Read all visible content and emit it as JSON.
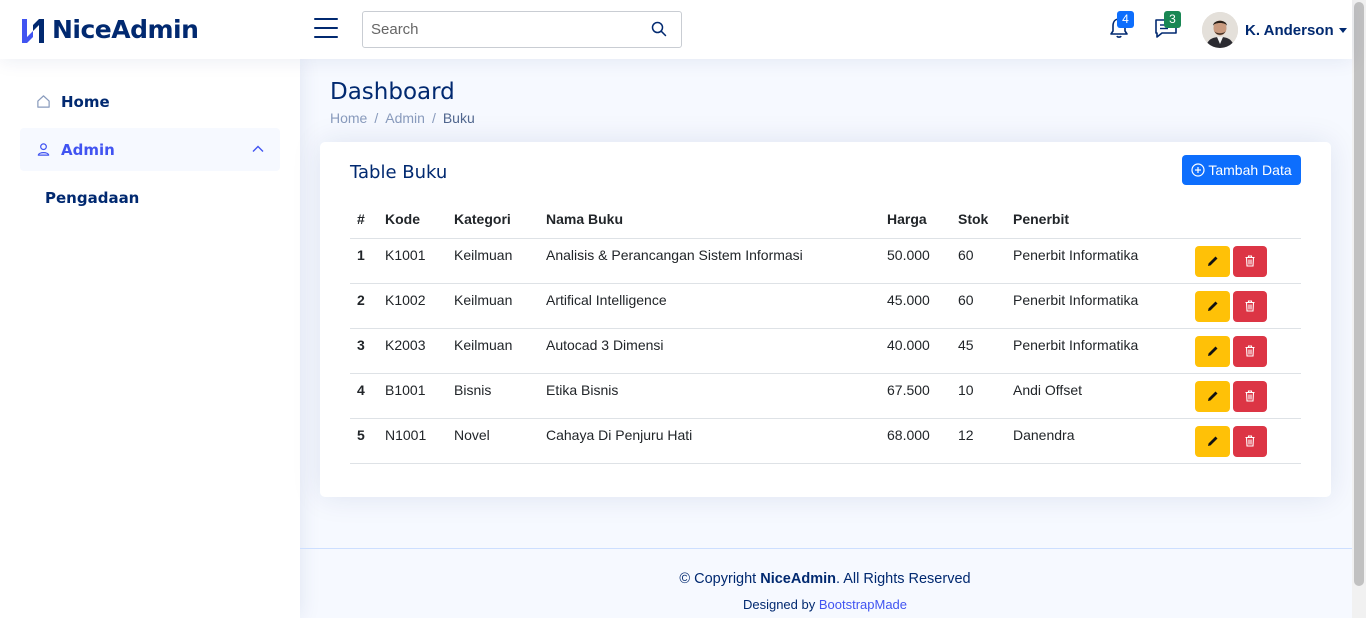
{
  "app": {
    "logo_text": "NiceAdmin"
  },
  "header": {
    "search_placeholder": "Search",
    "notifications": {
      "count": "4",
      "color": "#0d6efd",
      "icon": "bell-icon"
    },
    "messages": {
      "count": "3",
      "color": "#198754",
      "icon": "chat-left-text-icon"
    },
    "profile_name": "K. Anderson"
  },
  "sidebar": {
    "items": [
      {
        "label": "Home",
        "icon": "house-icon"
      },
      {
        "label": "Admin",
        "icon": "person-icon",
        "expanded": true
      }
    ],
    "sub_items": [
      {
        "label": "Pengadaan"
      }
    ]
  },
  "page": {
    "title": "Dashboard",
    "breadcrumb": [
      "Home",
      "Admin",
      "Buku"
    ]
  },
  "card": {
    "title": "Table Buku",
    "add_button": "Tambah Data",
    "columns": [
      "#",
      "Kode",
      "Kategori",
      "Nama Buku",
      "Harga",
      "Stok",
      "Penerbit",
      ""
    ],
    "rows": [
      {
        "no": "1",
        "kode": "K1001",
        "kategori": "Keilmuan",
        "nama": "Analisis & Perancangan Sistem Informasi",
        "harga": "50.000",
        "stok": "60",
        "penerbit": "Penerbit Informatika"
      },
      {
        "no": "2",
        "kode": "K1002",
        "kategori": "Keilmuan",
        "nama": "Artifical Intelligence",
        "harga": "45.000",
        "stok": "60",
        "penerbit": "Penerbit Informatika"
      },
      {
        "no": "3",
        "kode": "K2003",
        "kategori": "Keilmuan",
        "nama": "Autocad 3 Dimensi",
        "harga": "40.000",
        "stok": "45",
        "penerbit": "Penerbit Informatika"
      },
      {
        "no": "4",
        "kode": "B1001",
        "kategori": "Bisnis",
        "nama": "Etika Bisnis",
        "harga": "67.500",
        "stok": "10",
        "penerbit": "Andi Offset"
      },
      {
        "no": "5",
        "kode": "N1001",
        "kategori": "Novel",
        "nama": "Cahaya Di Penjuru Hati",
        "harga": "68.000",
        "stok": "12",
        "penerbit": "Danendra"
      }
    ]
  },
  "footer": {
    "copyright_prefix": "© Copyright ",
    "copyright_brand": "NiceAdmin",
    "copyright_suffix": ". All Rights Reserved",
    "designed_by": "Designed by ",
    "designer_link": "BootstrapMade"
  },
  "colors": {
    "primary": "#012970",
    "accent": "#4154f1",
    "edit": "#ffc107",
    "delete": "#dc3545",
    "button": "#0d6efd"
  }
}
